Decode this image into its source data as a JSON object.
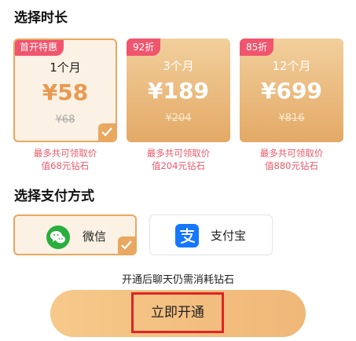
{
  "duration_section": {
    "title": "选择时长",
    "plans": [
      {
        "badge": "首开特惠",
        "duration": "1个月",
        "price": "¥58",
        "original_price": "¥68",
        "note_line1": "最多共可领取价",
        "note_line2": "值68元钻石",
        "selected": true
      },
      {
        "badge": "92折",
        "duration": "3个月",
        "price": "¥189",
        "original_price": "¥204",
        "note_line1": "最多共可领取价",
        "note_line2": "值204元钻石",
        "selected": false
      },
      {
        "badge": "85折",
        "duration": "12个月",
        "price": "¥699",
        "original_price": "¥816",
        "note_line1": "最多共可领取价",
        "note_line2": "值880元钻石",
        "selected": false
      }
    ]
  },
  "payment_section": {
    "title": "选择支付方式",
    "options": [
      {
        "label": "微信",
        "icon": "wechat-icon",
        "selected": true
      },
      {
        "label": "支付宝",
        "icon": "alipay-icon",
        "selected": false
      }
    ]
  },
  "notice": "开通后聊天仍需消耗钻石",
  "action": {
    "open_label": "立即开通"
  },
  "colors": {
    "accent": "#e8a860",
    "badge": "#f0556e",
    "note": "#e85a6a",
    "wechat": "#2aae3e",
    "alipay": "#1677ff",
    "highlight_box": "#e02424"
  }
}
